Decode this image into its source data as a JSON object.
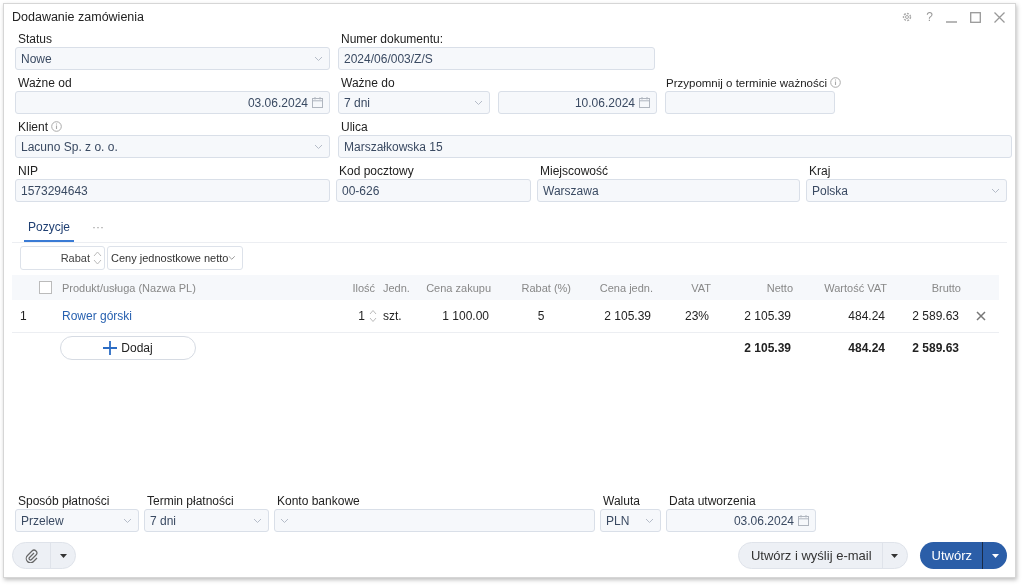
{
  "window": {
    "title": "Dodawanie zamówienia",
    "help_label": "?"
  },
  "form_rows": [
    [
      {
        "label": "Status",
        "value": "Nowe",
        "kind": "select"
      },
      {
        "label": "Numer dokumentu:",
        "value": "2024/06/003/Z/S",
        "kind": "text"
      }
    ],
    [
      {
        "label": "Ważne od",
        "value": "03.06.2024",
        "kind": "date"
      },
      {
        "label": "Ważne do",
        "value": "7 dni",
        "kind": "select"
      },
      {
        "value": "10.06.2024",
        "kind": "date"
      },
      {
        "label": "Przypomnij o terminie ważności",
        "kind": "text",
        "info": true
      }
    ],
    [
      {
        "label": "Klient",
        "value": "Lacuno Sp. z o. o.",
        "kind": "select",
        "info": true
      },
      {
        "label": "Ulica",
        "value": "Marszałkowska 15",
        "kind": "text"
      }
    ],
    [
      {
        "label": "NIP",
        "value": "1573294643",
        "kind": "text"
      },
      {
        "label": "Kod pocztowy",
        "value": "00-626",
        "kind": "text"
      },
      {
        "label": "Miejscowość",
        "value": "Warszawa",
        "kind": "text"
      },
      {
        "label": "Kraj",
        "value": "Polska",
        "kind": "select"
      }
    ]
  ],
  "tabs": [
    {
      "label": "Pozycje",
      "selected": true
    },
    {
      "label": "···",
      "selected": false
    }
  ],
  "toolbar": {
    "discount_label": "Rabat",
    "price_mode": "Ceny jednostkowe netto"
  },
  "table": {
    "select_all_checked": false,
    "columns": [
      "Produkt/usługa (Nazwa PL)",
      "Ilość",
      "Jedn.",
      "Cena zakupu",
      "Rabat (%)",
      "Cena jedn.",
      "VAT",
      "Netto",
      "Wartość VAT",
      "Brutto"
    ],
    "rows": [
      {
        "number": "1",
        "cells": [
          "Rower górski",
          "1",
          "szt.",
          "1 100.00",
          "5",
          "2 105.39",
          "23%",
          "2 105.39",
          "484.24",
          "2 589.63"
        ]
      }
    ],
    "add_button": "Dodaj",
    "totals": {
      "net": "2 105.39",
      "vat_value": "484.24",
      "gross": "2 589.63"
    }
  },
  "payment_fields": [
    {
      "label": "Sposób płatności",
      "value": "Przelew",
      "kind": "select"
    },
    {
      "label": "Termin płatności",
      "value": "7 dni",
      "kind": "select"
    },
    {
      "label": "Konto bankowe",
      "kind": "select"
    },
    {
      "label": "Waluta",
      "value": "PLN",
      "kind": "select"
    },
    {
      "label": "Data utworzenia",
      "value": "03.06.2024",
      "kind": "date"
    }
  ],
  "actions": [
    {
      "label": "Utwórz i wyślij e-mail",
      "kind": "secondary"
    },
    {
      "label": "Utwórz",
      "kind": "primary"
    }
  ]
}
